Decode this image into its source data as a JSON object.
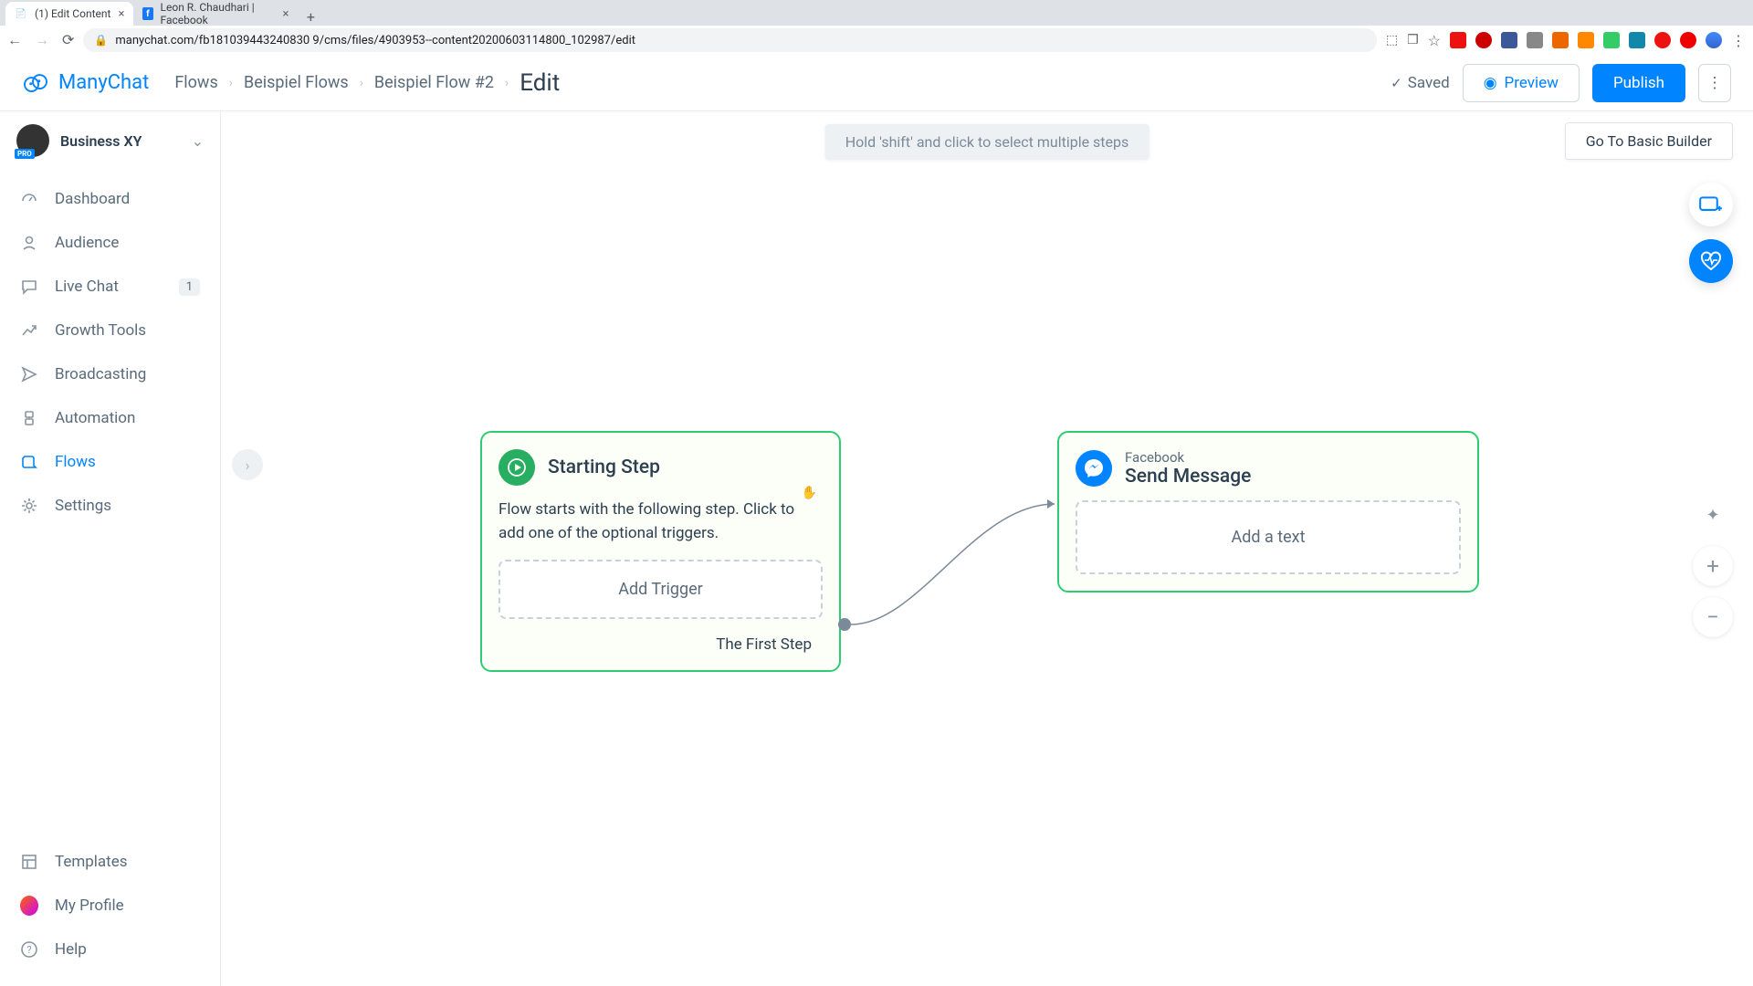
{
  "browser": {
    "tabs": [
      {
        "title": "(1) Edit Content",
        "favicon_color": "#888"
      },
      {
        "title": "Leon R. Chaudhari | Facebook",
        "favicon_color": "#1877f2"
      }
    ],
    "url": "manychat.com/fb181039443240830 9/cms/files/4903953--content20200603114800_102987/edit"
  },
  "app": {
    "logo_text": "ManyChat",
    "breadcrumb": [
      "Flows",
      "Beispiel Flows",
      "Beispiel Flow #2"
    ],
    "current": "Edit",
    "saved_label": "Saved",
    "preview_label": "Preview",
    "publish_label": "Publish"
  },
  "account": {
    "name": "Business XY",
    "pro_badge": "PRO"
  },
  "sidebar": {
    "items": [
      {
        "label": "Dashboard",
        "icon": "dashboard"
      },
      {
        "label": "Audience",
        "icon": "audience"
      },
      {
        "label": "Live Chat",
        "icon": "chat",
        "badge": "1"
      },
      {
        "label": "Growth Tools",
        "icon": "growth"
      },
      {
        "label": "Broadcasting",
        "icon": "broadcast"
      },
      {
        "label": "Automation",
        "icon": "automation"
      },
      {
        "label": "Flows",
        "icon": "flows",
        "active": true
      },
      {
        "label": "Settings",
        "icon": "settings"
      }
    ],
    "bottom": [
      {
        "label": "Templates",
        "icon": "templates"
      },
      {
        "label": "My Profile",
        "icon": "profile"
      },
      {
        "label": "Help",
        "icon": "help"
      }
    ]
  },
  "canvas": {
    "hint": "Hold 'shift' and click to select multiple steps",
    "basic_builder_label": "Go To Basic Builder"
  },
  "cards": {
    "start": {
      "title": "Starting Step",
      "desc": "Flow starts with the following step. Click to add one of the optional triggers.",
      "add_trigger_label": "Add Trigger",
      "footer_label": "The First Step"
    },
    "send": {
      "subtitle": "Facebook",
      "title": "Send Message",
      "add_text_label": "Add a text"
    }
  }
}
